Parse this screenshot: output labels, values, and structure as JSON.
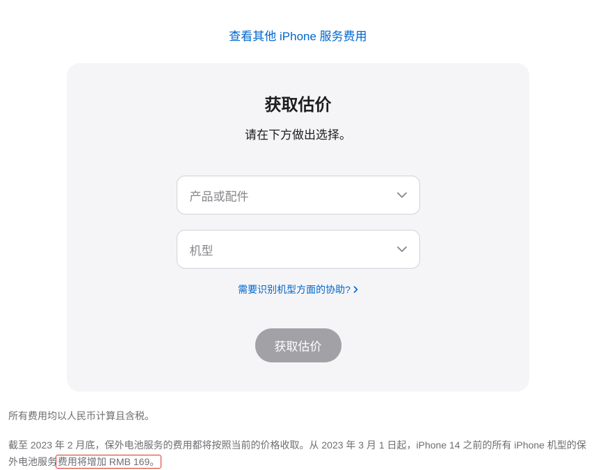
{
  "topLink": {
    "label": "查看其他 iPhone 服务费用"
  },
  "card": {
    "title": "获取估价",
    "subtitle": "请在下方做出选择。",
    "select1": {
      "placeholder": "产品或配件"
    },
    "select2": {
      "placeholder": "机型"
    },
    "helpLink": {
      "label": "需要识别机型方面的协助?"
    },
    "submitButton": {
      "label": "获取估价"
    }
  },
  "footer": {
    "line1": "所有费用均以人民币计算且含税。",
    "line2_part1": "截至 2023 年 2 月底，保外电池服务的费用都将按照当前的价格收取。从 2023 年 3 月 1 日起，iPhone 14 之前的所有 iPhone 机型的保外电池服务",
    "line2_highlight": "费用将增加 RMB 169。"
  }
}
